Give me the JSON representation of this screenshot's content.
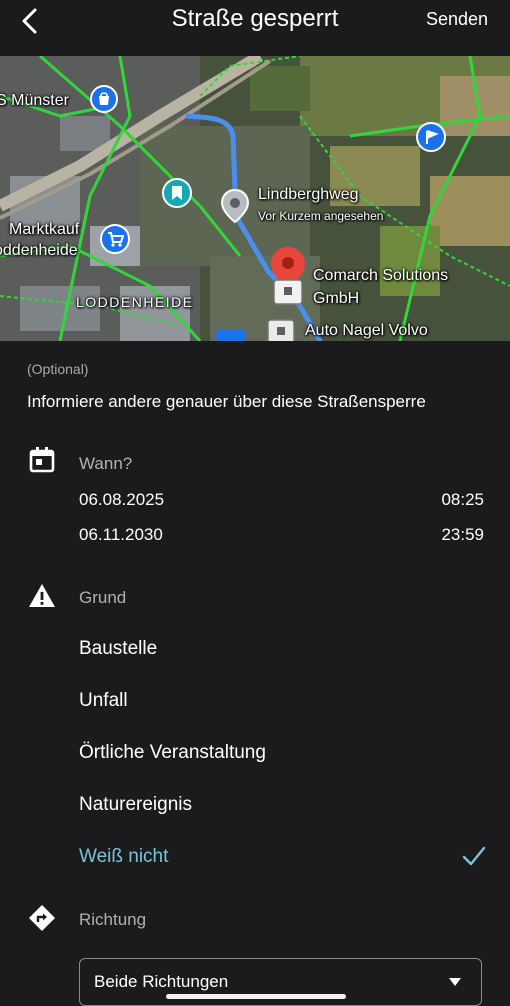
{
  "header": {
    "title": "Straße gesperrt",
    "send_label": "Senden"
  },
  "map": {
    "labels": {
      "s_muenster": "S Münster",
      "lindberghweg": "Lindberghweg",
      "lindberghweg_sub": "Vor Kurzem angesehen",
      "marktkauf_line1": "Marktkauf",
      "marktkauf_line2": "oddenheide",
      "comarch_line1": "Comarch Solutions",
      "comarch_line2": "GmbH",
      "auto_nagel": "Auto Nagel Volvo",
      "loddenheide": "LODDENHEIDE"
    },
    "colors": {
      "route": "#4a8ff0",
      "pin": "#e8463a",
      "poi": "#1a73e8"
    }
  },
  "form": {
    "optional": "(Optional)",
    "info": "Informiere andere genauer über diese Straßensperre",
    "when": {
      "label": "Wann?",
      "start_date": "06.08.2025",
      "start_time": "08:25",
      "end_date": "06.11.2030",
      "end_time": "23:59"
    },
    "reason": {
      "label": "Grund",
      "options": [
        "Baustelle",
        "Unfall",
        "Örtliche Veranstaltung",
        "Naturereignis",
        "Weiß nicht"
      ],
      "selected": "Weiß nicht"
    },
    "direction": {
      "label": "Richtung",
      "value": "Beide Richtungen"
    }
  },
  "colors": {
    "accent": "#7cc3d6",
    "background": "#1b1b1d"
  }
}
